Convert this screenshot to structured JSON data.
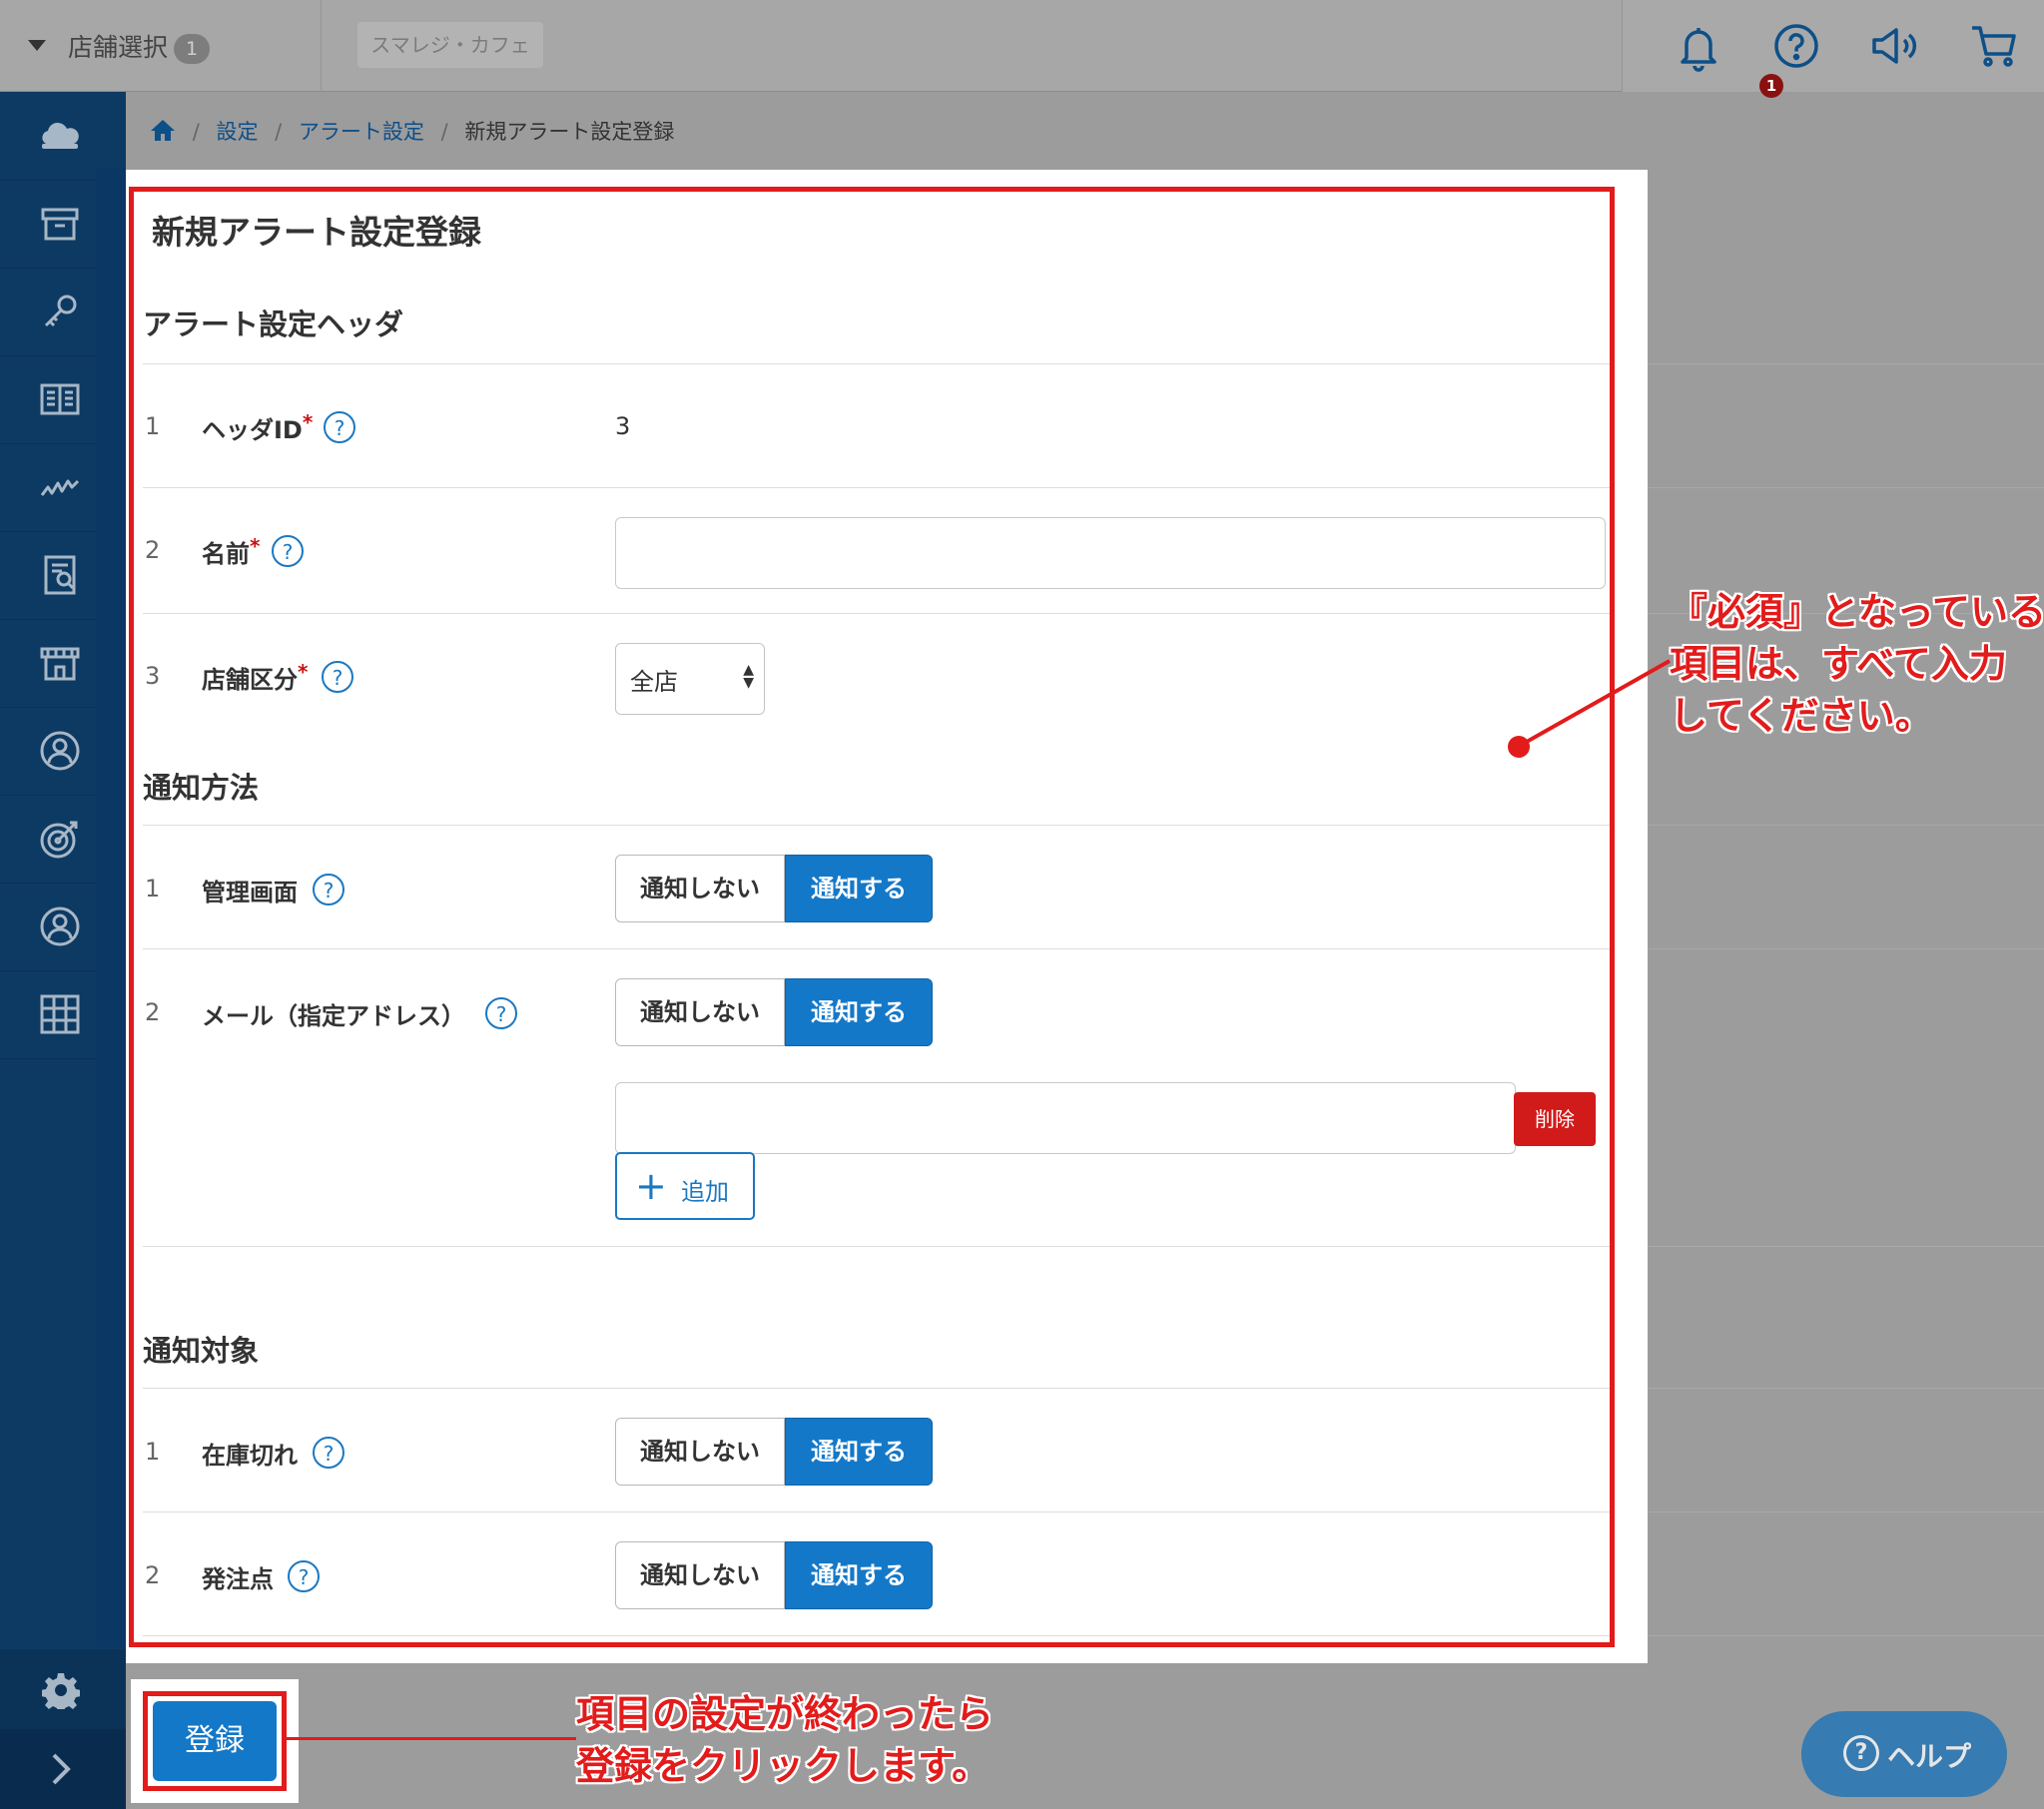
{
  "topbar": {
    "store_select_label": "店舗選択",
    "store_select_count": "1",
    "store_name": "スマレジ・カフェ",
    "notification_count": "1"
  },
  "breadcrumb": {
    "items": [
      "設定",
      "アラート設定",
      "新規アラート設定登録"
    ],
    "separator": "/"
  },
  "page": {
    "title": "新規アラート設定登録",
    "sections": {
      "header": {
        "title": "アラート設定ヘッダ",
        "rows": [
          {
            "num": "1",
            "label": "ヘッダID",
            "required": "*",
            "value": "3"
          },
          {
            "num": "2",
            "label": "名前",
            "required": "*",
            "value": ""
          },
          {
            "num": "3",
            "label": "店舗区分",
            "required": "*",
            "value": "全店"
          }
        ]
      },
      "method": {
        "title": "通知方法",
        "rows": [
          {
            "num": "1",
            "label": "管理画面"
          },
          {
            "num": "2",
            "label": "メール（指定アドレス）"
          }
        ]
      },
      "target": {
        "title": "通知対象",
        "rows": [
          {
            "num": "1",
            "label": "在庫切れ"
          },
          {
            "num": "2",
            "label": "発注点"
          }
        ]
      }
    },
    "toggle": {
      "off_label": "通知しない",
      "on_label": "通知する",
      "selected": "通知する"
    },
    "help_mark": "?",
    "delete_label": "削除",
    "add_label": "追加",
    "register_label": "登録"
  },
  "annotations": {
    "required_note": [
      "『必須』となっている",
      "項目は、すべて入力",
      "してください。"
    ],
    "register_note": [
      "項目の設定が終わったら",
      "登録をクリックします。"
    ]
  },
  "help_fab": {
    "label": "ヘルプ",
    "mark": "?"
  },
  "colors": {
    "sidebar": "#0d3a63",
    "accent_blue": "#1478c8",
    "annotation_red": "#e21b1b",
    "delete_red": "#d11a1a"
  },
  "icons": {
    "sidebar": [
      "cloud-icon",
      "archive-icon",
      "key-icon",
      "book-icon",
      "chart-icon",
      "receipt-icon",
      "store-icon",
      "customer-icon",
      "target-icon",
      "user-icon",
      "grid-icon"
    ],
    "topbar": [
      "bell-icon",
      "question-icon",
      "megaphone-icon",
      "cart-icon"
    ]
  }
}
